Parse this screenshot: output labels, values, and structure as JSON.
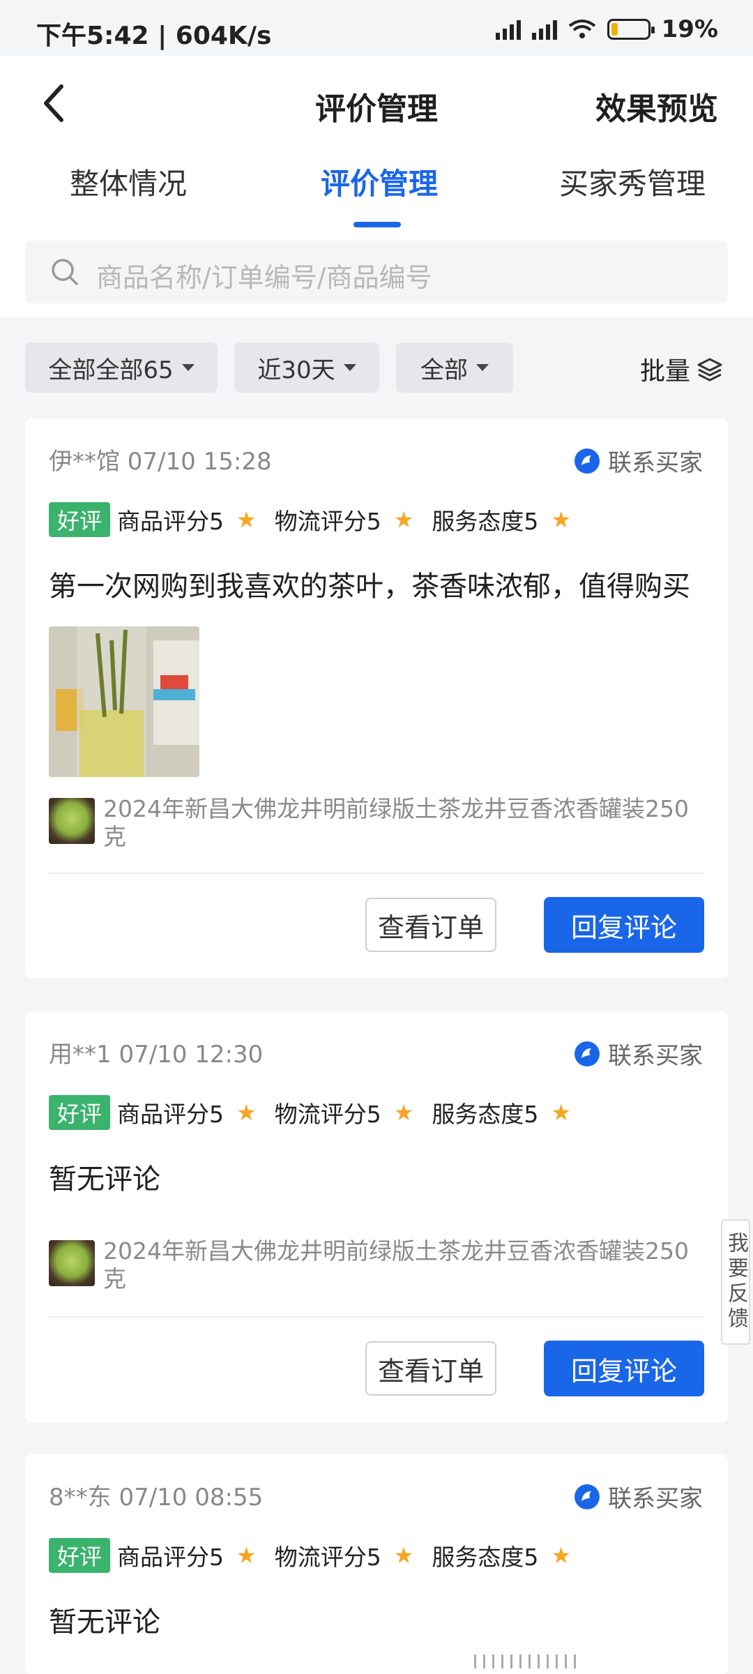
{
  "status_bar": {
    "time": "下午5:42",
    "speed": "604K/s",
    "battery": "19%",
    "battery_level": 0.19
  },
  "nav": {
    "title": "评价管理",
    "right_action": "效果预览"
  },
  "tabs": [
    {
      "label": "整体情况",
      "active": false
    },
    {
      "label": "评价管理",
      "active": true
    },
    {
      "label": "买家秀管理",
      "active": false
    }
  ],
  "search": {
    "placeholder": "商品名称/订单编号/商品编号"
  },
  "filters": {
    "type": "全部全部65",
    "range": "近30天",
    "status": "全部",
    "batch": "批量"
  },
  "reviews": [
    {
      "user": "伊**馆 07/10 15:28",
      "contact": "联系买家",
      "badge": "好评",
      "product_score": "商品评分5",
      "logistics_score": "物流评分5",
      "service_score": "服务态度5",
      "comment": "第一次网购到我喜欢的茶叶，茶香味浓郁，值得购买",
      "product_title": "2024年新昌大佛龙井明前绿版土茶龙井豆香浓香罐装250克",
      "view_order": "查看订单",
      "reply": "回复评论"
    },
    {
      "user": "用**1 07/10 12:30",
      "contact": "联系买家",
      "badge": "好评",
      "product_score": "商品评分5",
      "logistics_score": "物流评分5",
      "service_score": "服务态度5",
      "comment": "暂无评论",
      "product_title": "2024年新昌大佛龙井明前绿版土茶龙井豆香浓香罐装250克",
      "view_order": "查看订单",
      "reply": "回复评论"
    },
    {
      "user": "8**东 07/10 08:55",
      "contact": "联系买家",
      "badge": "好评",
      "product_score": "商品评分5",
      "logistics_score": "物流评分5",
      "service_score": "服务态度5",
      "comment": "暂无评论"
    }
  ],
  "feedback": "我要反馈",
  "colors": {
    "accent": "#1a66e8",
    "badge_green": "#3ab36c",
    "star": "#f5a623"
  }
}
